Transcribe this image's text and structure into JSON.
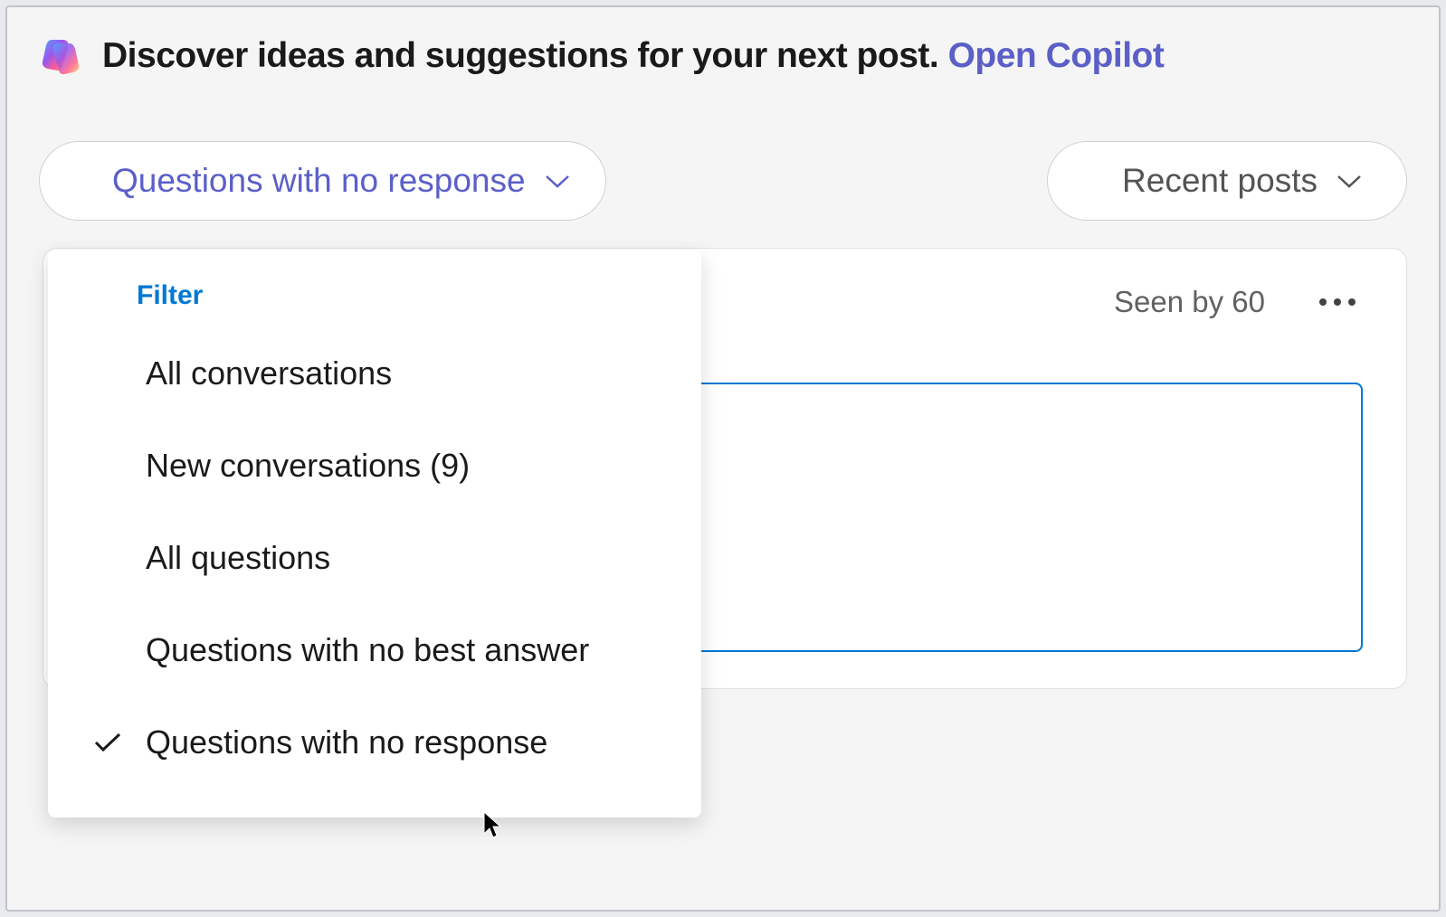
{
  "banner": {
    "text": "Discover ideas and suggestions for your next post. ",
    "link_text": "Open Copilot"
  },
  "filter_button": {
    "label": "Questions with no response"
  },
  "sort_button": {
    "label": "Recent posts"
  },
  "dropdown": {
    "header": "Filter",
    "items": [
      {
        "label": "All conversations",
        "selected": false
      },
      {
        "label": "New conversations (9)",
        "selected": false
      },
      {
        "label": "All questions",
        "selected": false
      },
      {
        "label": "Questions with no best answer",
        "selected": false
      },
      {
        "label": "Questions with no response",
        "selected": true
      }
    ]
  },
  "post": {
    "seen_label": "Seen by 60"
  }
}
